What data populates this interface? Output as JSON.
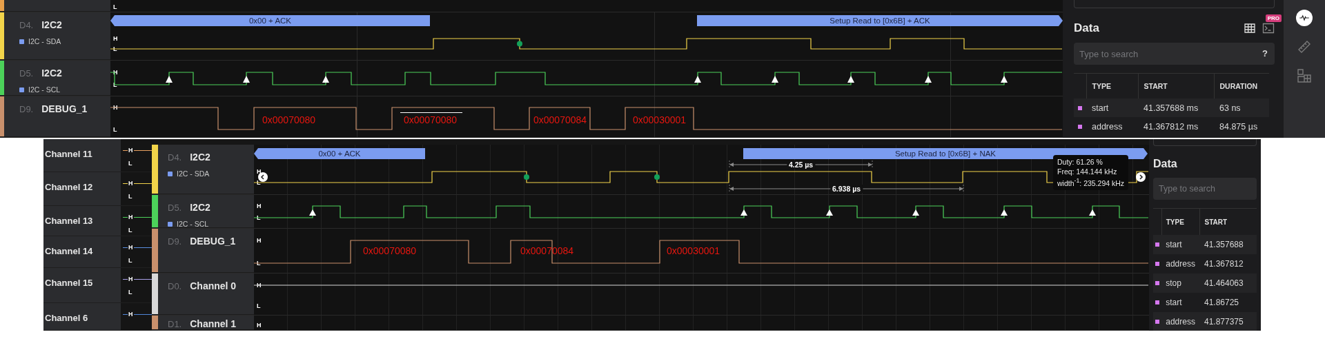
{
  "top_capture": {
    "partial_row": {
      "low_label": "L",
      "color": "#e8a04a"
    },
    "channels": [
      {
        "index": "D4.",
        "name": "I2C2",
        "analyzer": "I2C - SDA",
        "color": "#f2d44a",
        "high_label": "H",
        "low_label": "L"
      },
      {
        "index": "D5.",
        "name": "I2C2",
        "analyzer": "I2C - SCL",
        "color": "#4cd25a",
        "high_label": "H",
        "low_label": "L"
      },
      {
        "index": "D9.",
        "name": "DEBUG_1",
        "color": "#c9906c",
        "high_label": "H",
        "low_label": "L"
      }
    ],
    "bubbles": [
      "0x00 + ACK",
      "Setup Read to [0x6B] + ACK"
    ],
    "debug_labels": [
      "0x00070080",
      "0x00070080",
      "0x00070084",
      "0x00030001"
    ],
    "data_panel": {
      "title": "Data",
      "badge": "PRO",
      "search": {
        "placeholder": "Type to search",
        "help": "?"
      },
      "columns": [
        "TYPE",
        "START",
        "DURATION"
      ],
      "rows": [
        {
          "type": "start",
          "start": "41.357688 ms",
          "duration": "63 ns"
        },
        {
          "type": "address",
          "start": "41.367812 ms",
          "duration": "84.875 µs"
        }
      ]
    },
    "sidebar_tools": [
      {
        "kind": "activity",
        "selected": true
      },
      {
        "kind": "ruler",
        "selected": false
      },
      {
        "kind": "layout",
        "selected": false
      }
    ]
  },
  "bottom_capture": {
    "channel_list": [
      {
        "name": "Channel 11",
        "color": "#e8a060",
        "high_label": "H",
        "low_label": "L"
      },
      {
        "name": "Channel 12",
        "color": "#f2d44a",
        "high_label": "H",
        "low_label": "L"
      },
      {
        "name": "Channel 13",
        "color": "#4cd25a",
        "high_label": "H",
        "low_label": "L"
      },
      {
        "name": "Channel 14",
        "color": "#5a8ee0",
        "high_label": "H",
        "low_label": "L"
      },
      {
        "name": "Channel 15",
        "color": "#a9a0e8",
        "high_label": "H",
        "low_label": "L"
      },
      {
        "name": "Channel 6",
        "color": "#4f86d8",
        "high_label": "H"
      }
    ],
    "channels": [
      {
        "index": "D4.",
        "name": "I2C2",
        "analyzer": "I2C - SDA",
        "color": "#f2d44a",
        "high_label": "H",
        "low_label": "L"
      },
      {
        "index": "D5.",
        "name": "I2C2",
        "analyzer": "I2C - SCL",
        "color": "#4cd25a",
        "high_label": "H",
        "low_label": "L"
      },
      {
        "index": "D9.",
        "name": "DEBUG_1",
        "color": "#c9906c",
        "high_label": "H",
        "low_label": "L"
      },
      {
        "index": "D0.",
        "name": "Channel 0",
        "color": "#d8d8d8",
        "high_label": "H",
        "low_label": "L"
      },
      {
        "index": "D1.",
        "name": "Channel 1",
        "color": "#c9906c",
        "high_label": "H"
      }
    ],
    "bubbles": [
      "0x00 + ACK",
      "Setup Read to [0x6B] + NAK"
    ],
    "debug_labels": [
      "0x00070080",
      "0x00070084",
      "0x00030001"
    ],
    "measurements": [
      "4.25 µs",
      "6.938 µs"
    ],
    "tooltip": [
      "Duty: 61.26 %",
      "Freq: 144.144 kHz",
      "width$^{-1}$: 235.294 kHz"
    ],
    "data_panel": {
      "title": "Data",
      "search": {
        "placeholder": "Type to search"
      },
      "columns": [
        "TYPE",
        "START"
      ],
      "rows": [
        {
          "type": "start",
          "start": "41.357688"
        },
        {
          "type": "address",
          "start": "41.367812"
        },
        {
          "type": "stop",
          "start": "41.464063"
        },
        {
          "type": "start",
          "start": "41.86725"
        },
        {
          "type": "address",
          "start": "41.877375"
        }
      ]
    }
  }
}
